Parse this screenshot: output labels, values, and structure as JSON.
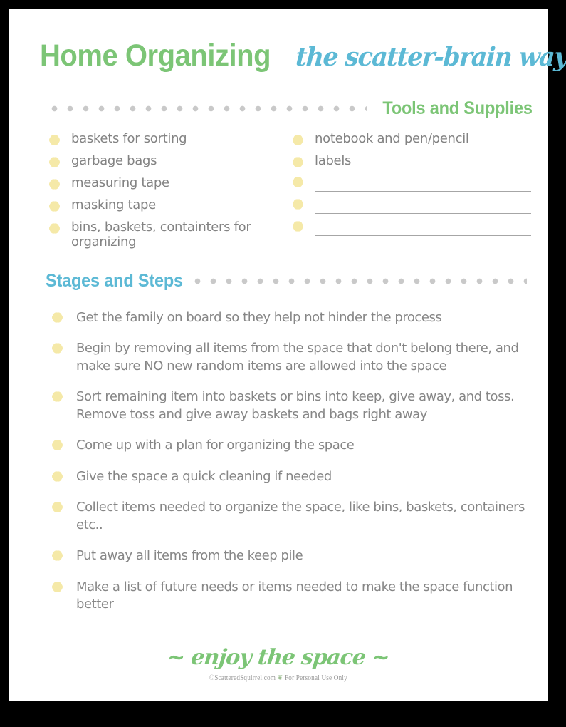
{
  "header": {
    "title_main": "Home Organizing",
    "title_script": "the scatter-brain way"
  },
  "sections": {
    "tools_label": "Tools and Supplies",
    "stages_label": "Stages and Steps"
  },
  "supplies": {
    "left_column": [
      "baskets for sorting",
      "garbage bags",
      "measuring tape",
      "masking tape",
      "bins, baskets, containters for organizing"
    ],
    "right_column": [
      "notebook and pen/pencil",
      "labels",
      "",
      "",
      ""
    ]
  },
  "steps": [
    "Get the family on board so they help not hinder the process",
    "Begin by removing all items from the space that don't belong there, and make sure NO new random items are allowed into the space",
    "Sort remaining item into baskets or bins into keep, give away, and toss.  Remove toss and give away baskets and bags right away",
    "Come up with a plan for organizing the space",
    "Give the space a quick cleaning if needed",
    "Collect items needed to organize the space, like bins, baskets, containers etc..",
    "Put away all items from the keep pile",
    "Make a list of future needs or items needed to make the space function better"
  ],
  "footer": {
    "script": "~ enjoy the space ~",
    "credit_prefix": "©ScatteredSquirrel.com",
    "credit_leaf": "❦",
    "credit_suffix": "For Personal Use Only"
  },
  "colors": {
    "green": "#7cc576",
    "blue": "#5cb9d5",
    "bullet_yellow": "#f5e9a8",
    "text_gray": "#868686",
    "dot_gray": "#c9c9c9",
    "border_black": "#000000"
  }
}
